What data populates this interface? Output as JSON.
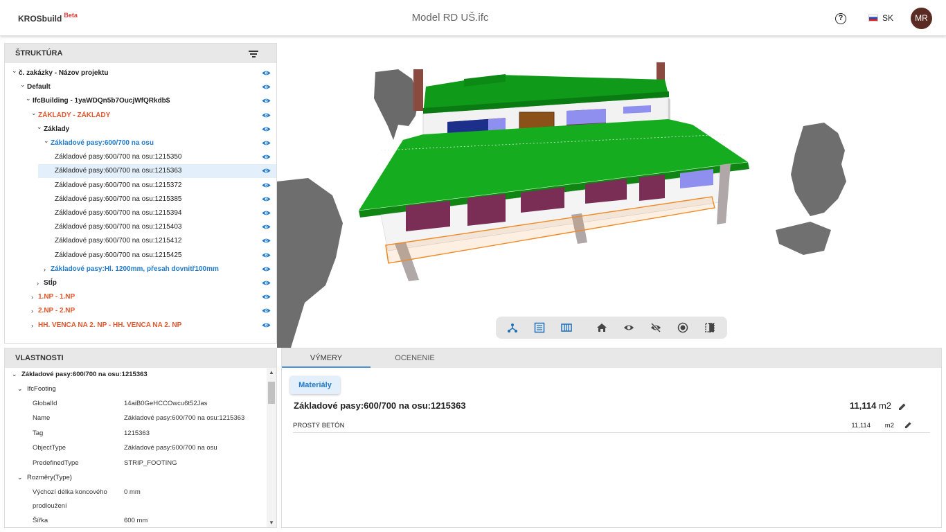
{
  "header": {
    "brand": "KROSbuild",
    "beta": "Beta",
    "title": "Model RD UŠ.ifc",
    "help": "?",
    "language": "SK",
    "user_initials": "MR"
  },
  "structure": {
    "title": "ŠTRUKTÚRA",
    "rows": [
      {
        "label": "č. zakázky - Názov projektu",
        "style": "bold",
        "expanded": true
      },
      {
        "label": "Default",
        "style": "bold",
        "expanded": true
      },
      {
        "label": "IfcBuilding - 1yaWDQn5b7OucjWfQRkdb$",
        "style": "bold",
        "expanded": true
      },
      {
        "label": "ZÁKLADY - ZÁKLADY",
        "style": "orange",
        "expanded": true
      },
      {
        "label": "Základy",
        "style": "bold",
        "expanded": true
      },
      {
        "label": "Základové pasy:600/700 na osu",
        "style": "blue",
        "expanded": true
      },
      {
        "label": "Základové pasy:600/700 na osu:1215350",
        "style": "normal"
      },
      {
        "label": "Základové pasy:600/700 na osu:1215363",
        "style": "normal",
        "selected": true
      },
      {
        "label": "Základové pasy:600/700 na osu:1215372",
        "style": "normal"
      },
      {
        "label": "Základové pasy:600/700 na osu:1215385",
        "style": "normal"
      },
      {
        "label": "Základové pasy:600/700 na osu:1215394",
        "style": "normal"
      },
      {
        "label": "Základové pasy:600/700 na osu:1215403",
        "style": "normal"
      },
      {
        "label": "Základové pasy:600/700 na osu:1215412",
        "style": "normal"
      },
      {
        "label": "Základové pasy:600/700 na osu:1215425",
        "style": "normal"
      },
      {
        "label": "Základové pasy:Hl. 1200mm, přesah dovnitř100mm",
        "style": "blue",
        "expanded": false
      },
      {
        "label": "Stĺp",
        "style": "bold",
        "expanded": false
      },
      {
        "label": "1.NP - 1.NP",
        "style": "orange",
        "expanded": false
      },
      {
        "label": "2.NP - 2.NP",
        "style": "orange",
        "expanded": false
      },
      {
        "label": "HH. VENCA NA 2. NP - HH. VENCA NA 2. NP",
        "style": "orange",
        "expanded": false
      }
    ]
  },
  "properties": {
    "title": "VLASTNOSTI",
    "element": "Základové pasy:600/700 na osu:1215363",
    "groups": [
      {
        "name": "IfcFooting",
        "items": [
          {
            "key": "GlobalId",
            "value": "14aiB0GeHCCOwcu6t52Jas"
          },
          {
            "key": "Name",
            "value": "Základové pasy:600/700 na osu:1215363"
          },
          {
            "key": "Tag",
            "value": "1215363"
          },
          {
            "key": "ObjectType",
            "value": "Základové pasy:600/700 na osu"
          },
          {
            "key": "PredefinedType",
            "value": "STRIP_FOOTING"
          }
        ]
      },
      {
        "name": "Rozměry(Type)",
        "items": [
          {
            "key": "Výchozí délka koncového",
            "key2": "prodloužení",
            "value": "0 mm"
          },
          {
            "key": "Šířka",
            "value": "600 mm"
          }
        ]
      }
    ]
  },
  "main": {
    "tabs": [
      {
        "label": "VÝMERY",
        "active": true
      },
      {
        "label": "OCENENIE",
        "active": false
      }
    ],
    "materials_button": "Materiály",
    "element_title": "Základové pasy:600/700 na osu:1215363",
    "total_value": "11,114",
    "total_unit": "m2",
    "material_rows": [
      {
        "name": "PROSTÝ BETÓN",
        "value": "11,114",
        "unit": "m2"
      }
    ]
  },
  "viewer_toolbar": {
    "icons": [
      "tree-icon",
      "list-icon",
      "table-icon",
      "home-icon",
      "eye-icon",
      "eye-off-icon",
      "record-icon",
      "split-view-icon"
    ]
  },
  "colors": {
    "accent_blue": "#1f7acd",
    "accent_orange": "#e2552a",
    "roof_green": "#0f9a1a",
    "selection": "#e3effa",
    "avatar": "#5a2b22"
  }
}
